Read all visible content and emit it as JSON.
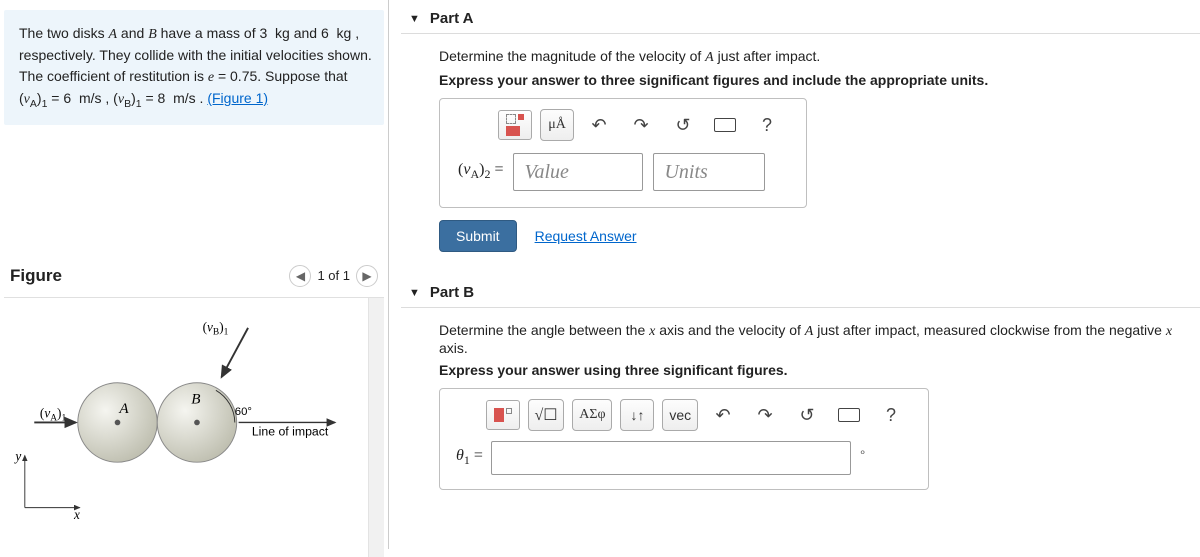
{
  "problem": {
    "text_prefix": "The two disks ",
    "disk_a": "A",
    "and": " and ",
    "disk_b": "B",
    "have_mass": " have a mass of 3  kg and 6  kg , respectively. They collide with the initial velocities shown. The coefficient of restitution is ",
    "e_eq": "e",
    "e_val": " = 0.75. Suppose that ",
    "va_sym": "(v",
    "va_sub": "A",
    "va_rest": ")",
    "one": "1",
    "va_val": " = 6  m/s , ",
    "vb_sym": "(v",
    "vb_sub": "B",
    "vb_rest": ")",
    "vb_val": " = 8  m/s . ",
    "figlink": "(Figure 1)"
  },
  "figure": {
    "title": "Figure",
    "counter": "1 of 1",
    "labels": {
      "A": "A",
      "B": "B",
      "vA": "(vA)1",
      "vB": "(vB)1",
      "angle": "60°",
      "line": "Line of impact",
      "x": "x",
      "y": "y"
    }
  },
  "partA": {
    "title": "Part A",
    "prompt": "Determine the magnitude of the velocity of A just after impact.",
    "instr": "Express your answer to three significant figures and include the appropriate units.",
    "lhs_sym": "(v",
    "lhs_sub": "A",
    "lhs_rest": ")",
    "lhs_two": "2",
    "equals": " = ",
    "value_ph": "Value",
    "units_ph": "Units",
    "submit": "Submit",
    "request": "Request Answer",
    "mu": "μÅ",
    "help": "?"
  },
  "partB": {
    "title": "Part B",
    "prompt": "Determine the angle between the x axis and the velocity of A just after impact, measured clockwise from the negative x axis.",
    "instr": "Express your answer using three significant figures.",
    "theta": "θ",
    "sub1": "1",
    "equals": " = ",
    "greek": "ΑΣφ",
    "updown": "↓↑",
    "vec": "vec",
    "help": "?",
    "deg": "∘"
  }
}
